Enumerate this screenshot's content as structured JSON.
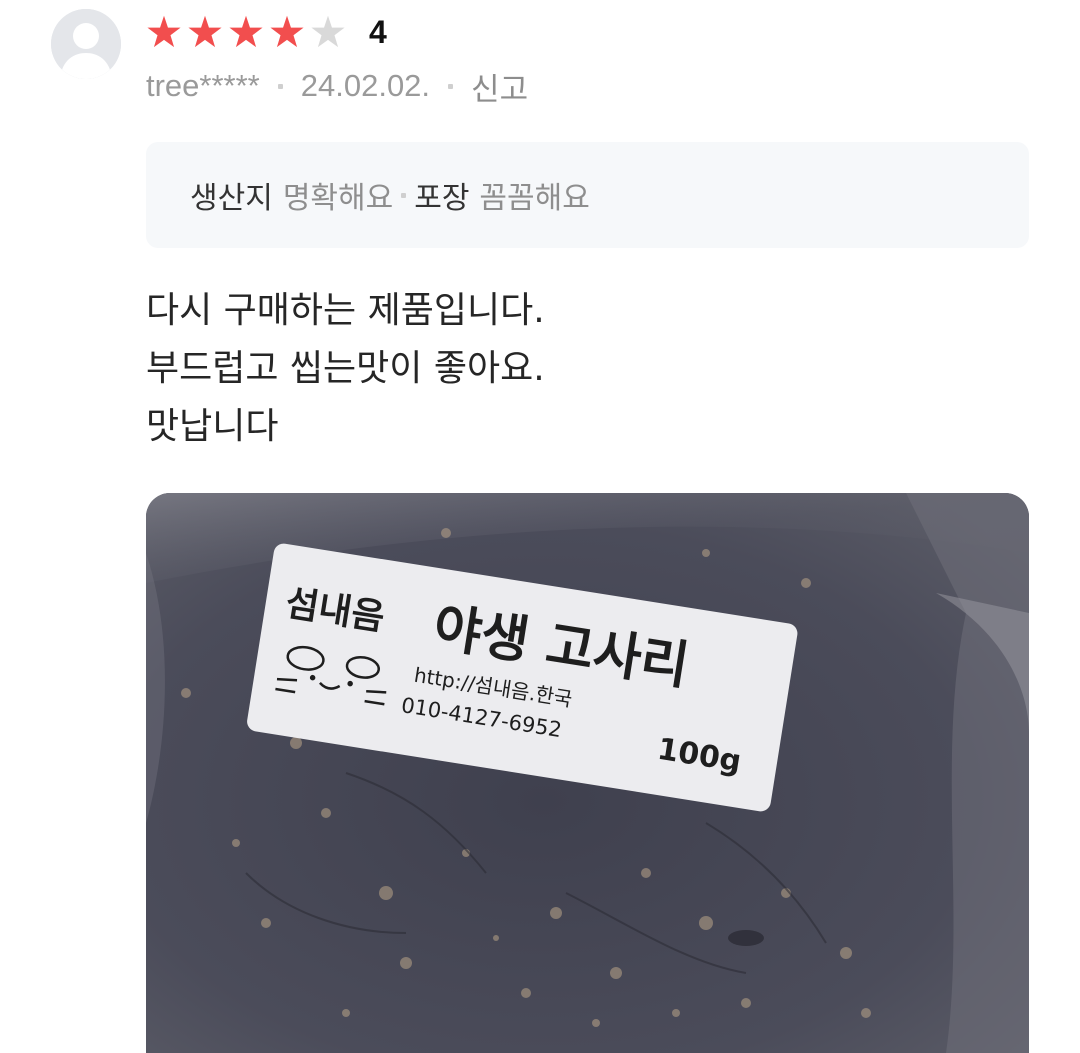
{
  "review": {
    "rating": {
      "score": "4",
      "stars_filled": 4,
      "stars_total": 5,
      "filled_color": "#f24e4e",
      "empty_color": "#d9d9d9"
    },
    "author": "tree*****",
    "date": "24.02.02.",
    "report_label": "신고",
    "avatar_icon": "default-user-avatar",
    "attributes": [
      {
        "key": "생산지",
        "value": "명확해요"
      },
      {
        "key": "포장",
        "value": "꼼꼼해요"
      }
    ],
    "body_lines": [
      "다시 구매하는 제품입니다.",
      "부드럽고 씹는맛이 좋아요.",
      "맛납니다"
    ],
    "photo": {
      "label_brand": "섬내음",
      "label_title": "야생 고사리",
      "label_url": "http://섬내음.한국",
      "label_phone": "010-4127-6952",
      "label_weight": "100g"
    }
  }
}
